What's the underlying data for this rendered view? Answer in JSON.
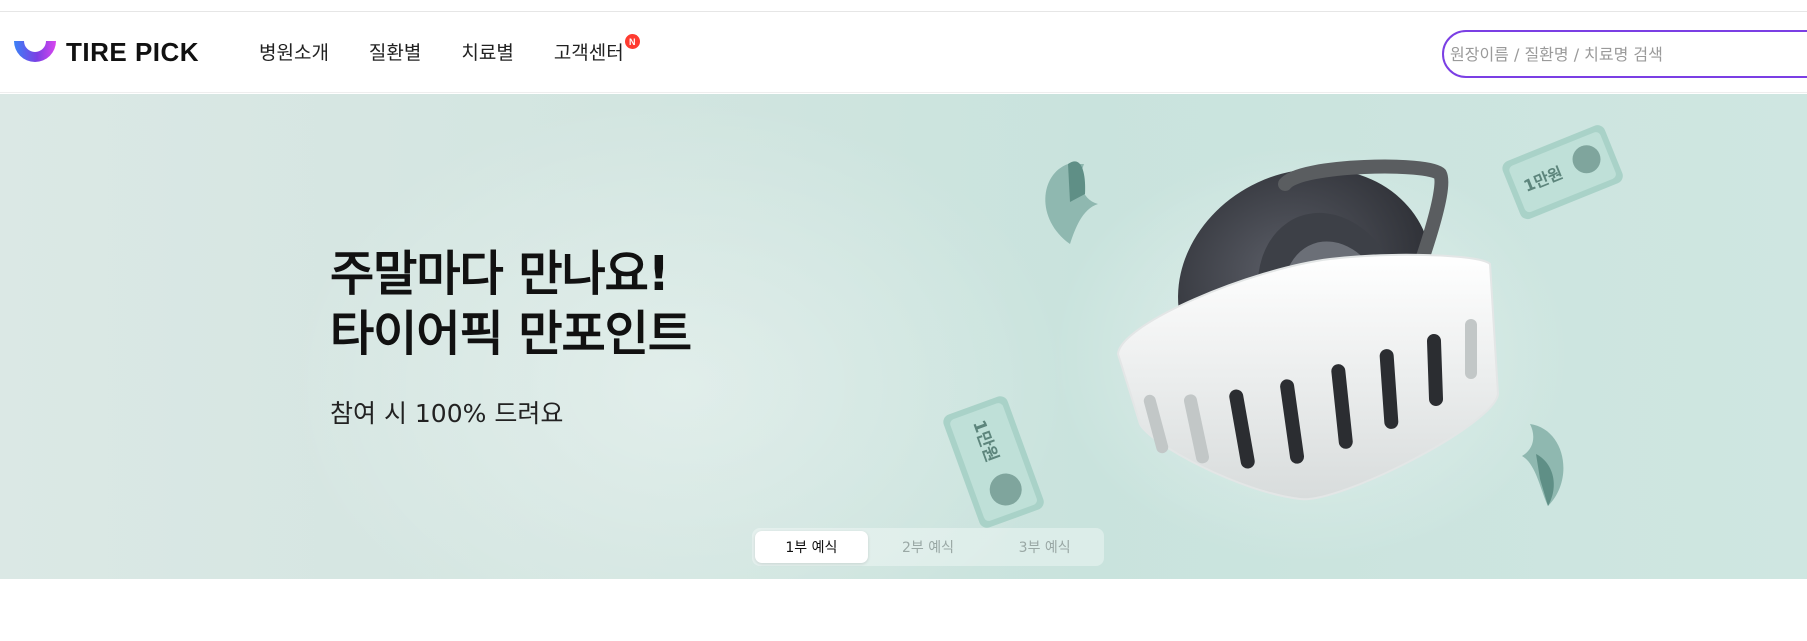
{
  "topbar": {
    "links": [
      "",
      "",
      ""
    ]
  },
  "header": {
    "logo": {
      "text": "TIRE PICK",
      "brand_colors": [
        "#3b82f6",
        "#7b3fe4",
        "#d946ef"
      ]
    },
    "nav": [
      {
        "label": "병원소개"
      },
      {
        "label": "질환별"
      },
      {
        "label": "치료별"
      },
      {
        "label": "고객센터",
        "badge": "N"
      }
    ],
    "search": {
      "placeholder": "원장이름 / 질환명 / 치료명 검색",
      "value": "",
      "accent": "#7b3fe4"
    }
  },
  "hero": {
    "title_line1": "주말마다 만나요!",
    "title_line2": "타이어픽 만포인트",
    "subtitle": "참여 시 100% 드려요",
    "banknote_text": "1만원",
    "tabs": [
      {
        "label": "1부 예식",
        "active": true
      },
      {
        "label": "2부 예식",
        "active": false
      },
      {
        "label": "3부 예식",
        "active": false
      }
    ],
    "background": "#cfe5e0"
  }
}
